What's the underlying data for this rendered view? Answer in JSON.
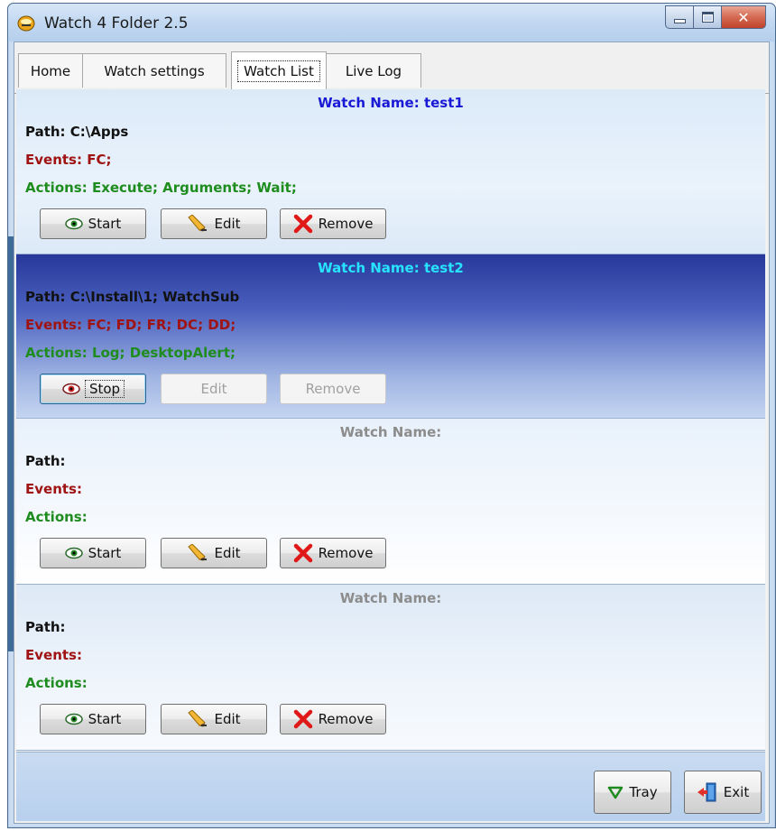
{
  "window": {
    "title": "Watch 4 Folder 2.5"
  },
  "tabs": [
    {
      "label": "Home"
    },
    {
      "label": "Watch settings"
    },
    {
      "label": "Watch List",
      "active": true
    },
    {
      "label": "Live Log"
    }
  ],
  "watches": [
    {
      "name": "Watch Name: test1",
      "name_color": "#1a1ad6",
      "path": "Path: C:\\Apps",
      "events": "Events: FC;",
      "actions": "Actions: Execute; Arguments; Wait;",
      "toggle_label": "Start",
      "edit_label": "Edit",
      "remove_label": "Remove",
      "active": false
    },
    {
      "name": "Watch Name: test2",
      "name_color": "#27e3ff",
      "path": "Path: C:\\Install\\1; WatchSub",
      "events": "Events: FC; FD; FR; DC; DD;",
      "actions": "Actions: Log; DesktopAlert;",
      "toggle_label": "Stop",
      "edit_label": "Edit",
      "remove_label": "Remove",
      "active": true
    },
    {
      "name": "Watch Name:",
      "name_color": "#8c8c8c",
      "path": "Path:",
      "events": "Events:",
      "actions": "Actions:",
      "toggle_label": "Start",
      "edit_label": "Edit",
      "remove_label": "Remove",
      "active": false
    },
    {
      "name": "Watch Name:",
      "name_color": "#8c8c8c",
      "path": "Path:",
      "events": "Events:",
      "actions": "Actions:",
      "toggle_label": "Start",
      "edit_label": "Edit",
      "remove_label": "Remove",
      "active": false
    }
  ],
  "footer": {
    "tray_label": "Tray",
    "exit_label": "Exit"
  },
  "icons": {
    "app": "watch-folder-app-icon",
    "start": "eye-icon",
    "stop": "eye-red-icon",
    "edit": "pencil-icon",
    "remove": "red-x-icon",
    "tray": "green-triangle-down-icon",
    "exit": "exit-door-icon"
  }
}
